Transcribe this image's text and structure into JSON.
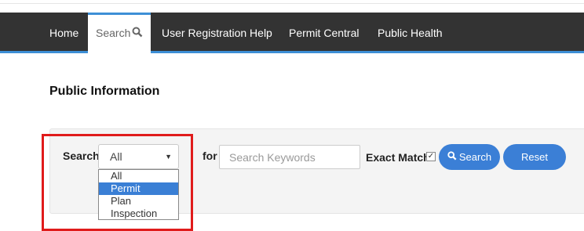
{
  "nav": {
    "items": [
      {
        "label": "Home"
      },
      {
        "label": "Search"
      },
      {
        "label": "User Registration Help"
      },
      {
        "label": "Permit Central"
      },
      {
        "label": "Public Health"
      }
    ],
    "active_index": 1
  },
  "page": {
    "title": "Public Information"
  },
  "search_form": {
    "search_label": "Search",
    "type_select": {
      "value": "All",
      "options": [
        "All",
        "Permit",
        "Plan",
        "Inspection"
      ],
      "highlighted_option": "Permit"
    },
    "for_label": "for",
    "keywords_placeholder": "Search Keywords",
    "exact_match_label": "Exact Match",
    "exact_match_checked": true,
    "search_button": "Search",
    "reset_button": "Reset"
  },
  "colors": {
    "navbar_bg": "#333333",
    "accent_blue": "#3b7fd6",
    "highlight_red": "#e01b1b"
  },
  "icons": {
    "search": "magnifier-icon",
    "select_arrow": "caret-down-icon",
    "checkbox_check": "checkmark-icon"
  }
}
